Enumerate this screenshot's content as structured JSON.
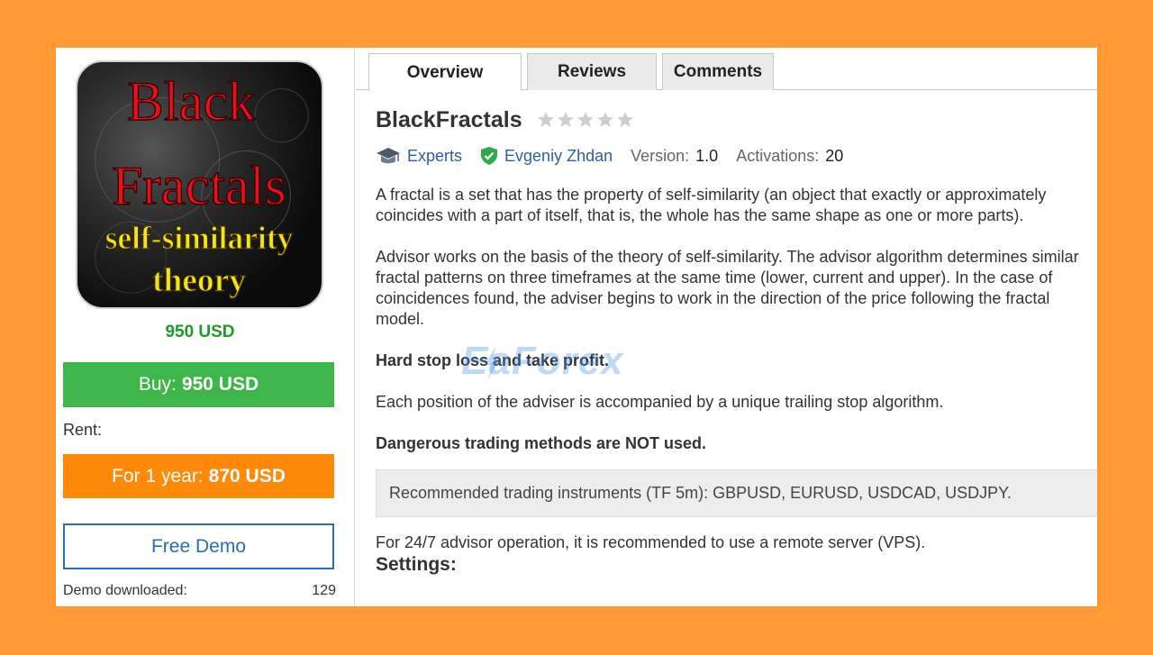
{
  "product": {
    "logo_lines": [
      "Black",
      "Fractals",
      "self-similarity",
      "theory"
    ],
    "price": "950 USD",
    "buy_label": "Buy:",
    "buy_price": "950 USD",
    "rent_label": "Rent:",
    "rent_period": "For 1 year:",
    "rent_price": "870 USD",
    "demo_label": "Free Demo",
    "demo_downloaded_label": "Demo downloaded:",
    "demo_downloaded_count": "129"
  },
  "tabs": [
    {
      "label": "Overview",
      "active": true
    },
    {
      "label": "Reviews",
      "active": false
    },
    {
      "label": "Comments",
      "active": false
    }
  ],
  "overview": {
    "title": "BlackFractals",
    "rating_stars": 5,
    "rating_filled": 0,
    "category": "Experts",
    "author": "Evgeniy Zhdan",
    "version_label": "Version:",
    "version": "1.0",
    "activations_label": "Activations:",
    "activations": "20",
    "para1": "A fractal is a set that has the property of self-similarity (an object that exactly or approximately coincides with a part of itself, that is, the whole has the same shape as one or more parts).",
    "para2": "Advisor works on the basis of the theory of self-similarity. The advisor algorithm determines similar fractal patterns on three timeframes at the same time (lower, current and upper). In the case of coincidences found, the adviser begins to work in the direction of the price following the fractal model.",
    "para3": "Hard stop loss and take profit.",
    "para4": "Each position of the adviser is accompanied by a unique trailing stop algorithm.",
    "para5": "Dangerous trading methods are NOT used.",
    "recommended": "Recommended trading instruments (TF 5m): GBPUSD, EURUSD, USDCAD, USDJPY.",
    "vps": "For 24/7 advisor operation, it is recommended to use a remote server (VPS).",
    "settings": "Settings:"
  },
  "watermark": "EaForex",
  "colors": {
    "background": "#ff9a35",
    "buy": "#3eb649",
    "rent": "#ff8a0a",
    "demo": "#2d6bb5",
    "price": "#1d9a27",
    "link": "#2d5fa0"
  }
}
